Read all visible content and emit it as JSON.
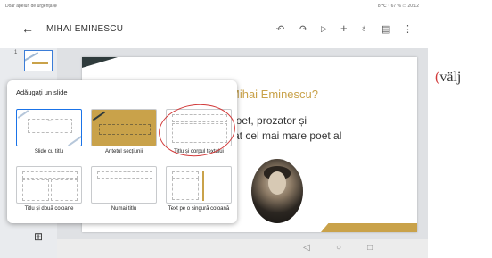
{
  "status": {
    "left": "Doar apeluri de urgență ⊕",
    "right": "8 ℃ ᵀ 67 % ▭ 20:12"
  },
  "header": {
    "title": "MIHAI EMINESCU"
  },
  "toolbar": {
    "back_icon": "arrow-left-icon",
    "icons": [
      "undo-icon",
      "redo-icon",
      "play-icon",
      "add-icon",
      "add-person-icon",
      "comment-icon",
      "more-vert-icon"
    ]
  },
  "sidebar": {
    "slide_number": "1"
  },
  "slide": {
    "title": "Mihai Eminescu?",
    "line1": "poet, prozator și",
    "line2": "rat cel mai mare poet al"
  },
  "dialog": {
    "title": "Adăugați un slide",
    "layouts": [
      {
        "name": "Slide cu titlu"
      },
      {
        "name": "Antetul secțiunii"
      },
      {
        "name": "Titlu și corpul textului"
      },
      {
        "name": "Titlu și două coloane"
      },
      {
        "name": "Numai titlu"
      },
      {
        "name": "Text pe o singură coloană"
      }
    ]
  },
  "annotation": {
    "open": "(",
    "text": "välj"
  },
  "colors": {
    "accent": "#c9a24a",
    "dark": "#2f3b3c",
    "selection": "#1a73e8",
    "annotation": "#d23a3a"
  }
}
